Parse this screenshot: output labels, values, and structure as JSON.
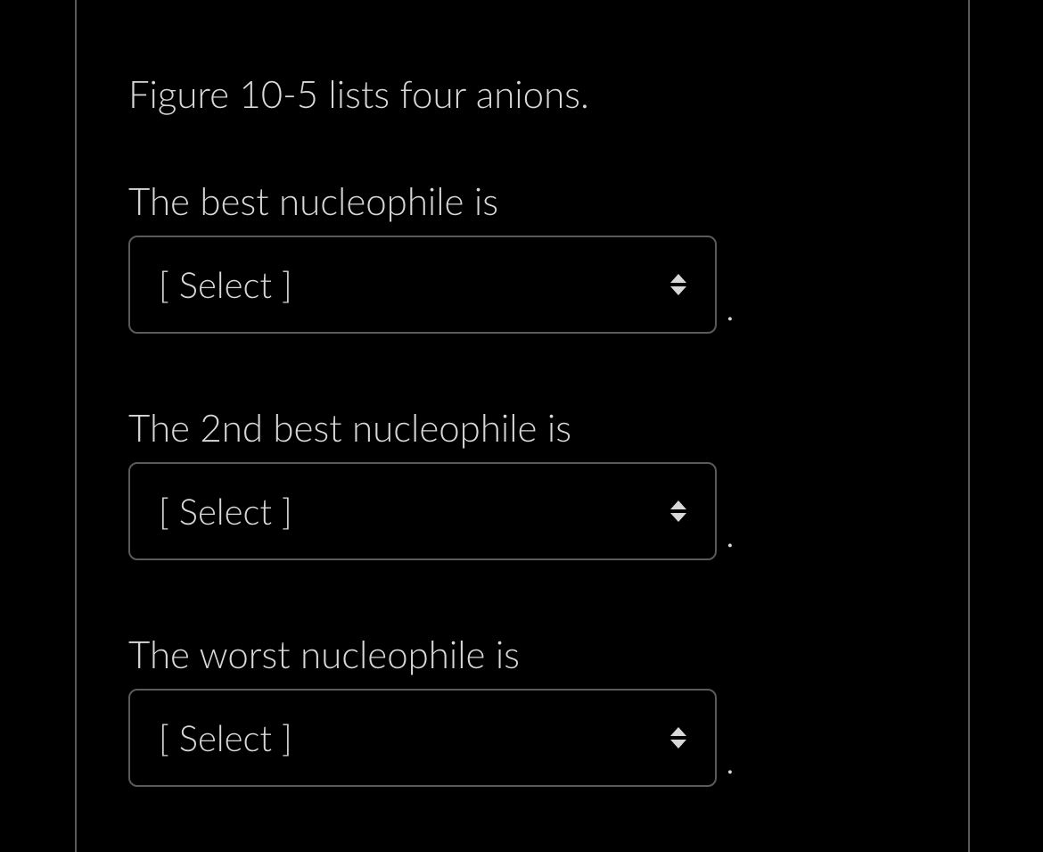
{
  "intro": "Figure 10-5 lists four anions.",
  "questions": [
    {
      "prompt": "The best nucleophile is",
      "select_placeholder": "[ Select ]",
      "trailing": "."
    },
    {
      "prompt": "The 2nd best nucleophile is",
      "select_placeholder": "[ Select ]",
      "trailing": "."
    },
    {
      "prompt": "The worst nucleophile is",
      "select_placeholder": "[ Select ]",
      "trailing": "."
    }
  ]
}
